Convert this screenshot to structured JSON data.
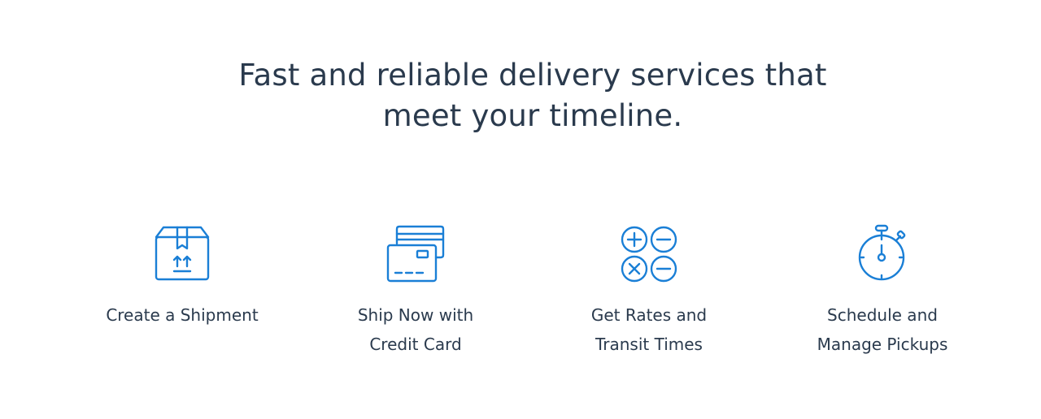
{
  "headline": {
    "line1": "Fast and reliable delivery services that",
    "line2": "meet your timeline."
  },
  "colors": {
    "icon": "#1a7fd6",
    "text": "#2a3a4d",
    "background": "#ffffff"
  },
  "services": [
    {
      "icon": "package-box-icon",
      "label_line1": "Create a Shipment",
      "label_line2": ""
    },
    {
      "icon": "credit-card-icon",
      "label_line1": "Ship Now with",
      "label_line2": "Credit Card"
    },
    {
      "icon": "calculator-operators-icon",
      "label_line1": "Get Rates and",
      "label_line2": "Transit Times"
    },
    {
      "icon": "stopwatch-icon",
      "label_line1": "Schedule and",
      "label_line2": "Manage Pickups"
    }
  ]
}
